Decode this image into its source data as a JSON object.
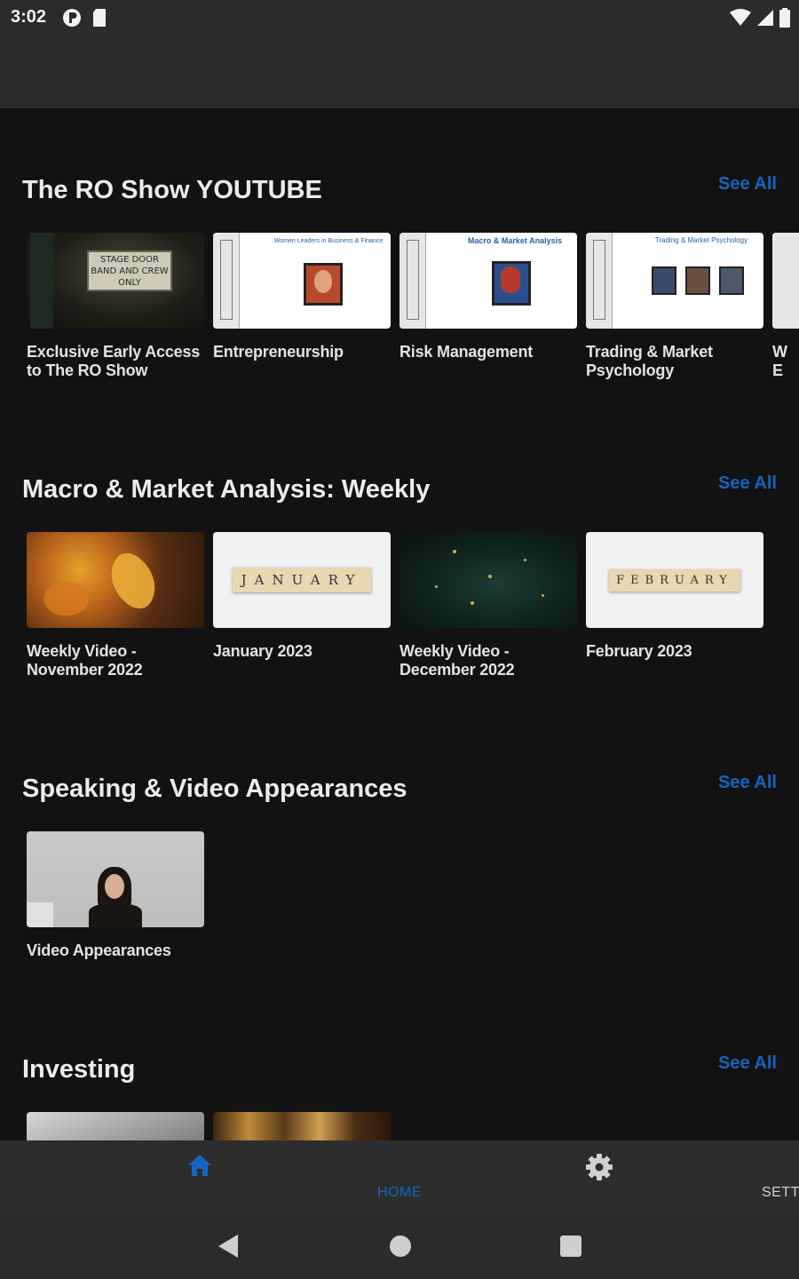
{
  "status_bar": {
    "time": "3:02",
    "left_icons": [
      "p-icon",
      "sd-card-icon"
    ],
    "right_icons": [
      "wifi-icon",
      "signal-icon",
      "battery-icon"
    ]
  },
  "sections": [
    {
      "title": "The RO Show YOUTUBE",
      "see_all": "See All",
      "cards": [
        {
          "title": "Exclusive Early Access to The RO Show"
        },
        {
          "title": "Entrepreneurship"
        },
        {
          "title": "Risk Management"
        },
        {
          "title": "Trading & Market Psychology"
        },
        {
          "title": "W E"
        }
      ]
    },
    {
      "title": "Macro & Market Analysis: Weekly",
      "see_all": "See All",
      "cards": [
        {
          "title": "Weekly Video - November 2022"
        },
        {
          "title": "January 2023",
          "thumb_text": "JANUARY"
        },
        {
          "title": "Weekly Video - December 2022"
        },
        {
          "title": "February 2023",
          "thumb_text": "FEBRUARY"
        }
      ]
    },
    {
      "title": "Speaking & Video Appearances",
      "see_all": "See All",
      "cards": [
        {
          "title": "Video Appearances"
        }
      ]
    },
    {
      "title": "Investing",
      "see_all": "See All",
      "cards": [
        {
          "title": ""
        },
        {
          "title": ""
        }
      ]
    }
  ],
  "thumb_text": {
    "stage_door": "STAGE DOOR BAND AND CREW ONLY",
    "entrepreneurship_header": "Women Leaders in Business & Finance",
    "risk_header": "Macro & Market Analysis",
    "trading_header": "Trading & Market Psychology"
  },
  "bottom_nav": {
    "home": {
      "label": "HOME",
      "icon": "home-icon",
      "active": true
    },
    "settings": {
      "label": "SETTINGS",
      "icon": "gear-icon",
      "active": false
    }
  },
  "system_nav": {
    "back": "back-icon",
    "home": "home-circle-icon",
    "recents": "recents-icon"
  },
  "colors": {
    "accent": "#1565c0",
    "background": "#121212",
    "bar": "#2b2b2b"
  }
}
